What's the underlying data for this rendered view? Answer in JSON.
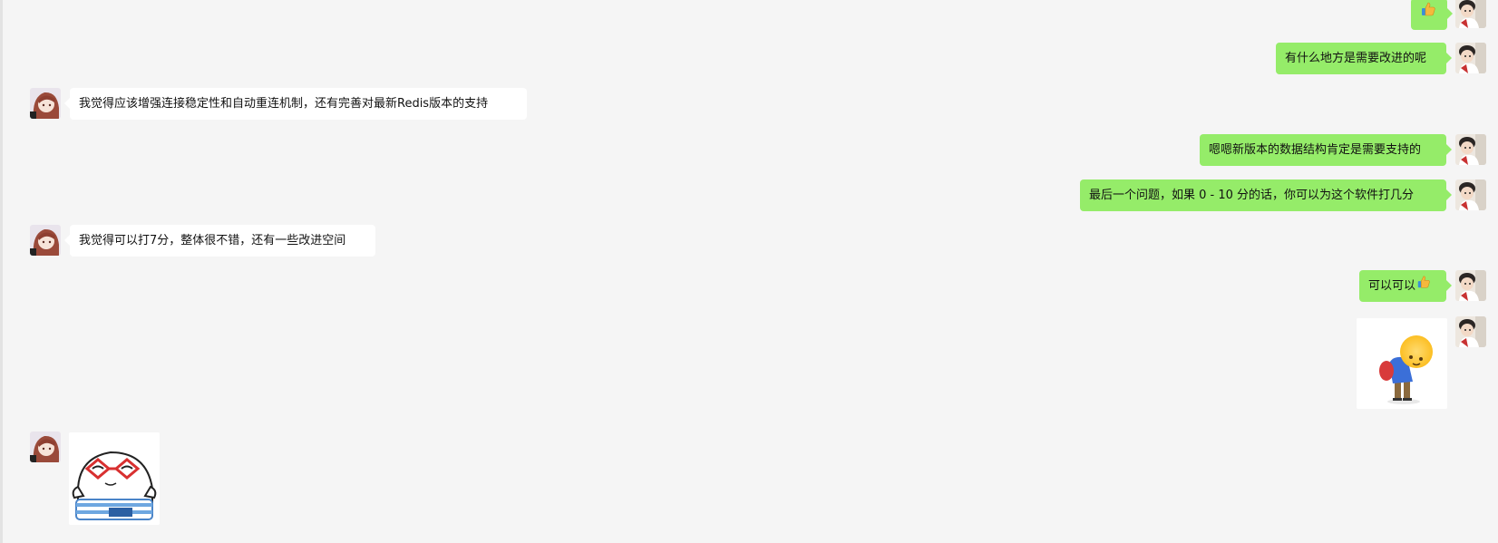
{
  "messages": [
    {
      "side": "me",
      "kind": "sticker-thumb",
      "text": ""
    },
    {
      "side": "me",
      "text": "有什么地方是需要改进的呢"
    },
    {
      "side": "other",
      "text": "我觉得应该增强连接稳定性和自动重连机制，还有完善对最新Redis版本的支持"
    },
    {
      "side": "me",
      "text": "嗯嗯新版本的数据结构肯定是需要支持的"
    },
    {
      "side": "me",
      "text": "最后一个问题，如果 0 - 10 分的话，你可以为这个软件打几分"
    },
    {
      "side": "other",
      "text": "我觉得可以打7分，整体很不错，还有一些改进空间"
    },
    {
      "side": "me",
      "text": "可以可以"
    },
    {
      "side": "me",
      "kind": "sticker",
      "sticker": "bowing-emoji-sticker"
    },
    {
      "side": "other",
      "kind": "sticker",
      "sticker": "sunglasses-blob-sticker"
    }
  ],
  "icons": {
    "thumbs_up": "thumbs-up-icon",
    "my_avatar": "my-avatar",
    "other_avatar": "other-avatar"
  },
  "colors": {
    "background": "#f5f5f5",
    "my_bubble": "#95ec69",
    "other_bubble": "#ffffff"
  }
}
